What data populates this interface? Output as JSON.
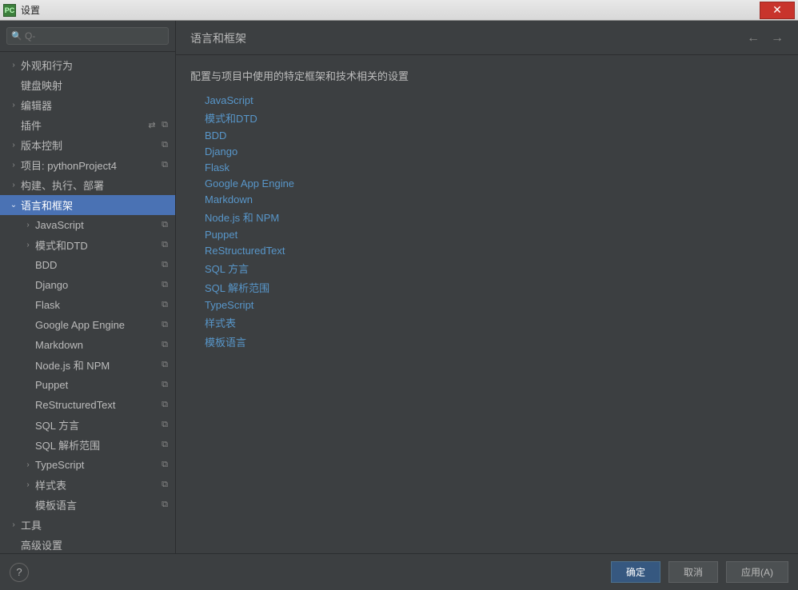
{
  "window": {
    "title": "设置",
    "icon_label": "PC"
  },
  "search": {
    "placeholder": "Q-",
    "value": ""
  },
  "sidebar": {
    "items": [
      {
        "label": "外观和行为",
        "depth": 0,
        "exp": "›",
        "badge": ""
      },
      {
        "label": "键盘映射",
        "depth": 0,
        "exp": "",
        "badge": ""
      },
      {
        "label": "编辑器",
        "depth": 0,
        "exp": "›",
        "badge": ""
      },
      {
        "label": "插件",
        "depth": 0,
        "exp": "",
        "badge": "⧉",
        "extra": "⇄"
      },
      {
        "label": "版本控制",
        "depth": 0,
        "exp": "›",
        "badge": "⧉"
      },
      {
        "label": "项目: pythonProject4",
        "depth": 0,
        "exp": "›",
        "badge": "⧉"
      },
      {
        "label": "构建、执行、部署",
        "depth": 0,
        "exp": "›",
        "badge": ""
      },
      {
        "label": "语言和框架",
        "depth": 0,
        "exp": "⌄",
        "badge": "",
        "selected": true
      },
      {
        "label": "JavaScript",
        "depth": 1,
        "exp": "›",
        "badge": "⧉"
      },
      {
        "label": "模式和DTD",
        "depth": 1,
        "exp": "›",
        "badge": "⧉"
      },
      {
        "label": "BDD",
        "depth": 1,
        "exp": "",
        "badge": "⧉"
      },
      {
        "label": "Django",
        "depth": 1,
        "exp": "",
        "badge": "⧉"
      },
      {
        "label": "Flask",
        "depth": 1,
        "exp": "",
        "badge": "⧉"
      },
      {
        "label": "Google App Engine",
        "depth": 1,
        "exp": "",
        "badge": "⧉"
      },
      {
        "label": "Markdown",
        "depth": 1,
        "exp": "",
        "badge": "⧉"
      },
      {
        "label": "Node.js 和 NPM",
        "depth": 1,
        "exp": "",
        "badge": "⧉"
      },
      {
        "label": "Puppet",
        "depth": 1,
        "exp": "",
        "badge": "⧉"
      },
      {
        "label": "ReStructuredText",
        "depth": 1,
        "exp": "",
        "badge": "⧉"
      },
      {
        "label": "SQL 方言",
        "depth": 1,
        "exp": "",
        "badge": "⧉"
      },
      {
        "label": "SQL 解析范围",
        "depth": 1,
        "exp": "",
        "badge": "⧉"
      },
      {
        "label": "TypeScript",
        "depth": 1,
        "exp": "›",
        "badge": "⧉"
      },
      {
        "label": "样式表",
        "depth": 1,
        "exp": "›",
        "badge": "⧉"
      },
      {
        "label": "模板语言",
        "depth": 1,
        "exp": "",
        "badge": "⧉"
      },
      {
        "label": "工具",
        "depth": 0,
        "exp": "›",
        "badge": ""
      },
      {
        "label": "高级设置",
        "depth": 0,
        "exp": "",
        "badge": ""
      }
    ]
  },
  "content": {
    "title": "语言和框架",
    "description": "配置与项目中使用的特定框架和技术相关的设置",
    "links": [
      "JavaScript",
      "模式和DTD",
      "BDD",
      "Django",
      "Flask",
      "Google App Engine",
      "Markdown",
      "Node.js 和 NPM",
      "Puppet",
      "ReStructuredText",
      "SQL 方言",
      "SQL 解析范围",
      "TypeScript",
      "样式表",
      "模板语言"
    ]
  },
  "footer": {
    "ok": "确定",
    "cancel": "取消",
    "apply": "应用(A)"
  }
}
